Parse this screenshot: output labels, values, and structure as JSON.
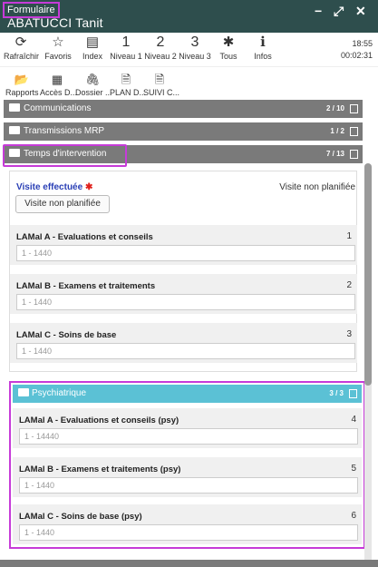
{
  "header": {
    "form_tag": "Formulaire",
    "patient_name": "ABATUCCI Tanit",
    "controls": [
      "−",
      "⤢",
      "✕"
    ]
  },
  "toolbar": {
    "items": [
      {
        "label": "Rafraîchir",
        "icon": "refresh-icon",
        "glyph": "⟳"
      },
      {
        "label": "Favoris",
        "icon": "star-icon",
        "glyph": "☆"
      },
      {
        "label": "Index",
        "icon": "index-icon",
        "glyph": "▤"
      },
      {
        "label": "Niveau 1",
        "icon": "level-1",
        "glyph": "1"
      },
      {
        "label": "Niveau 2",
        "icon": "level-2",
        "glyph": "2"
      },
      {
        "label": "Niveau 3",
        "icon": "level-3",
        "glyph": "3"
      },
      {
        "label": "Tous",
        "icon": "asterisk-icon",
        "glyph": "✱"
      },
      {
        "label": "Infos",
        "icon": "info-icon",
        "glyph": "ℹ"
      }
    ],
    "clock": {
      "time": "18:55",
      "elapsed": "00:02:31"
    }
  },
  "toolbar2": {
    "items": [
      {
        "label": "Rapports",
        "icon": "folder-open-icon",
        "glyph": "📂"
      },
      {
        "label": "Accès D...",
        "icon": "qr-code-icon",
        "glyph": "▦"
      },
      {
        "label": "Dossier ...",
        "icon": "paperclip-icon",
        "glyph": "🖇"
      },
      {
        "label": "PLAN D...",
        "icon": "document-icon",
        "glyph": "🗎"
      },
      {
        "label": "SUIVI C...",
        "icon": "pdf-icon",
        "glyph": "🗎"
      }
    ]
  },
  "sections": {
    "communications": {
      "label": "Communications",
      "count": "2 / 10"
    },
    "transmissions": {
      "label": "Transmissions MRP",
      "count": "1 / 2"
    },
    "temps": {
      "label": "Temps d'intervention",
      "count": "7 / 13"
    }
  },
  "visite": {
    "label": "Visite effectuée",
    "required": "✱",
    "right_text": "Visite non planifiée",
    "button": "Visite non planifiée"
  },
  "lamal": [
    {
      "title": "LAMal A - Evaluations et conseils",
      "num": "1",
      "placeholder": "1 - 1440"
    },
    {
      "title": "LAMal B - Examens et traitements",
      "num": "2",
      "placeholder": "1 - 1440"
    },
    {
      "title": "LAMal C - Soins de base",
      "num": "3",
      "placeholder": "1 - 1440"
    }
  ],
  "psychiatrique": {
    "label": "Psychiatrique",
    "count": "3 / 3",
    "items": [
      {
        "title": "LAMal A - Evaluations et conseils (psy)",
        "num": "4",
        "placeholder": "1 - 14440"
      },
      {
        "title": "LAMal B - Examens et traitements (psy)",
        "num": "5",
        "placeholder": "1 - 1440"
      },
      {
        "title": "LAMal C - Soins de base (psy)",
        "num": "6",
        "placeholder": "1 - 1440"
      }
    ]
  },
  "colors": {
    "header_bg": "#2e4e4d",
    "section_bg": "#7a7a7a",
    "psy_bar_bg": "#5bc1d5",
    "highlight": "#c63bd8",
    "visite_label": "#2a3fb5",
    "required": "#e0201b"
  }
}
